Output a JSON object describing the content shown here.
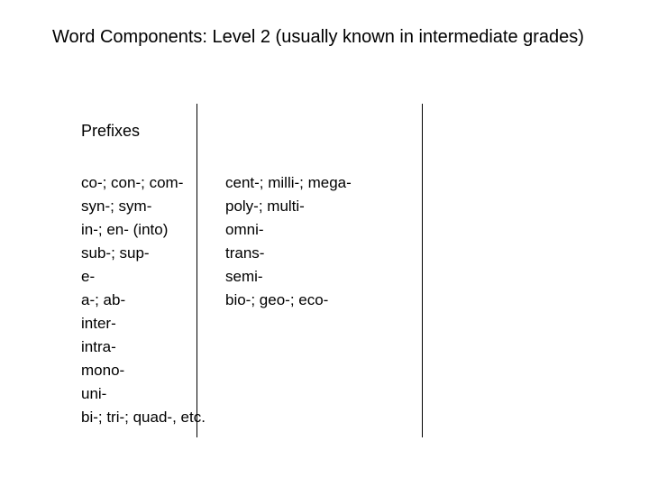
{
  "title": "Word Components: Level 2 (usually known in intermediate grades)",
  "section_heading": "Prefixes",
  "col1": [
    "co-; con-; com-",
    "syn-; sym-",
    "in-; en- (into)",
    "sub-; sup-",
    "e-",
    "a-; ab-",
    "inter-",
    "intra-",
    "mono-",
    "uni-",
    "bi-; tri-; quad-, etc."
  ],
  "col2": [
    "cent-; milli-; mega-",
    "poly-; multi-",
    "omni-",
    "trans-",
    "semi-",
    "bio-; geo-; eco-"
  ]
}
